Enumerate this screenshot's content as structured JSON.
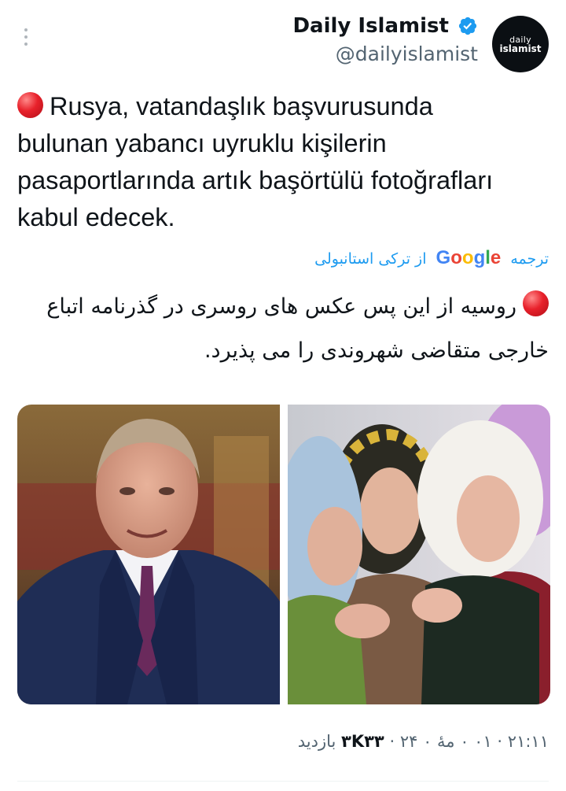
{
  "author": {
    "name": "Daily Islamist",
    "handle": "@dailyislamist",
    "avatar_line1": "daily",
    "avatar_line2": "islamist",
    "verified_color": "#1d9bf0"
  },
  "tweet": {
    "text": "Rusya, vatandaşlık başvurusunda bulunan yabancı uyruklu kişilerin pasaportlarında artık başörtülü fotoğrafları kabul edecek.",
    "emoji": "red-circle"
  },
  "translation": {
    "label_prefix": "ترجمه",
    "google": [
      "G",
      "o",
      "o",
      "g",
      "l",
      "e"
    ],
    "label_suffix": "از ترکی استانبولی",
    "text": "روسیه از این پس عکس های روسری در گذرنامه اتباع خارجی متقاضی شهروندی را می پذیرد."
  },
  "media": {
    "images": [
      {
        "name": "man-in-suit-photo"
      },
      {
        "name": "women-in-headscarves-photo"
      }
    ]
  },
  "meta": {
    "time": "۲۱:۱۱",
    "date": "۰۱ ۰ مهٔ ۰ ۲۴",
    "views_count": "۳K۳۳",
    "views_label": "بازدید",
    "separator": "·"
  },
  "colors": {
    "accent": "#1d9bf0",
    "text": "#0f1419",
    "muted": "#536471"
  }
}
